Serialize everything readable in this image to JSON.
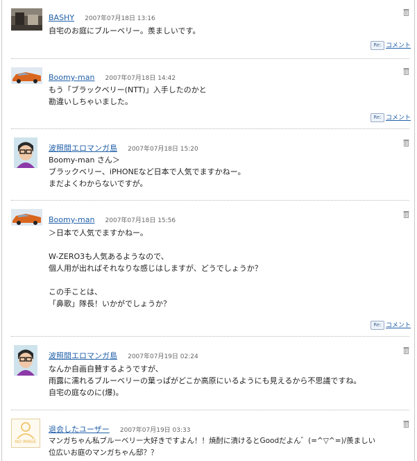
{
  "comments": [
    {
      "name": "BASHY",
      "date": "2007年07月18日 13:16",
      "body": "自宅のお庭にブルーベリー。羨ましいです。",
      "reply": "コメント",
      "re": "Re:"
    },
    {
      "name": "Boomy-man",
      "date": "2007年07月18日 14:42",
      "body": "もう「ブラックベリー(NTT)」入手したのかと\n勘違いしちゃいました。",
      "reply": "コメント",
      "re": "Re:"
    },
    {
      "name": "波照間エロマンガ島",
      "date": "2007年07月18日 15:20",
      "body": "Boomy-man さん＞\nブラックベリー、iPHONEなど日本で人気でますかねー。\nまだよくわからないですが。"
    },
    {
      "name": "Boomy-man",
      "date": "2007年07月18日 15:56",
      "body": "＞日本で人気でますかねー。\n\nW-ZERO3も人気あるようなので、\n個人用が出ればそれなりな感じはしますが、どうでしょうか？\n\nこの手ことは、\n「鼻歌」隊長！いかがでしょうか？",
      "reply": "コメント",
      "re": "Re:"
    },
    {
      "name": "波照間エロマンガ島",
      "date": "2007年07月19日 02:24",
      "body": "なんか自画自賛するようですが、\n雨露に濡れるブルーベリーの葉っぱがどこか高原にいるようにも見えるから不思議ですね。\n自宅の庭なのに(爆)。"
    },
    {
      "name": "退会したユーザー",
      "date": "2007年07月19日 03:33",
      "body": "マンガちゃん私ブルーベリー大好きですよん！！焼酎に漬けるとGoodだよん゛(=^▽^=)/羨ましい\n位広いお庭のマンガちゃん邸？？",
      "avatar_text": "NO IMAGE"
    }
  ]
}
